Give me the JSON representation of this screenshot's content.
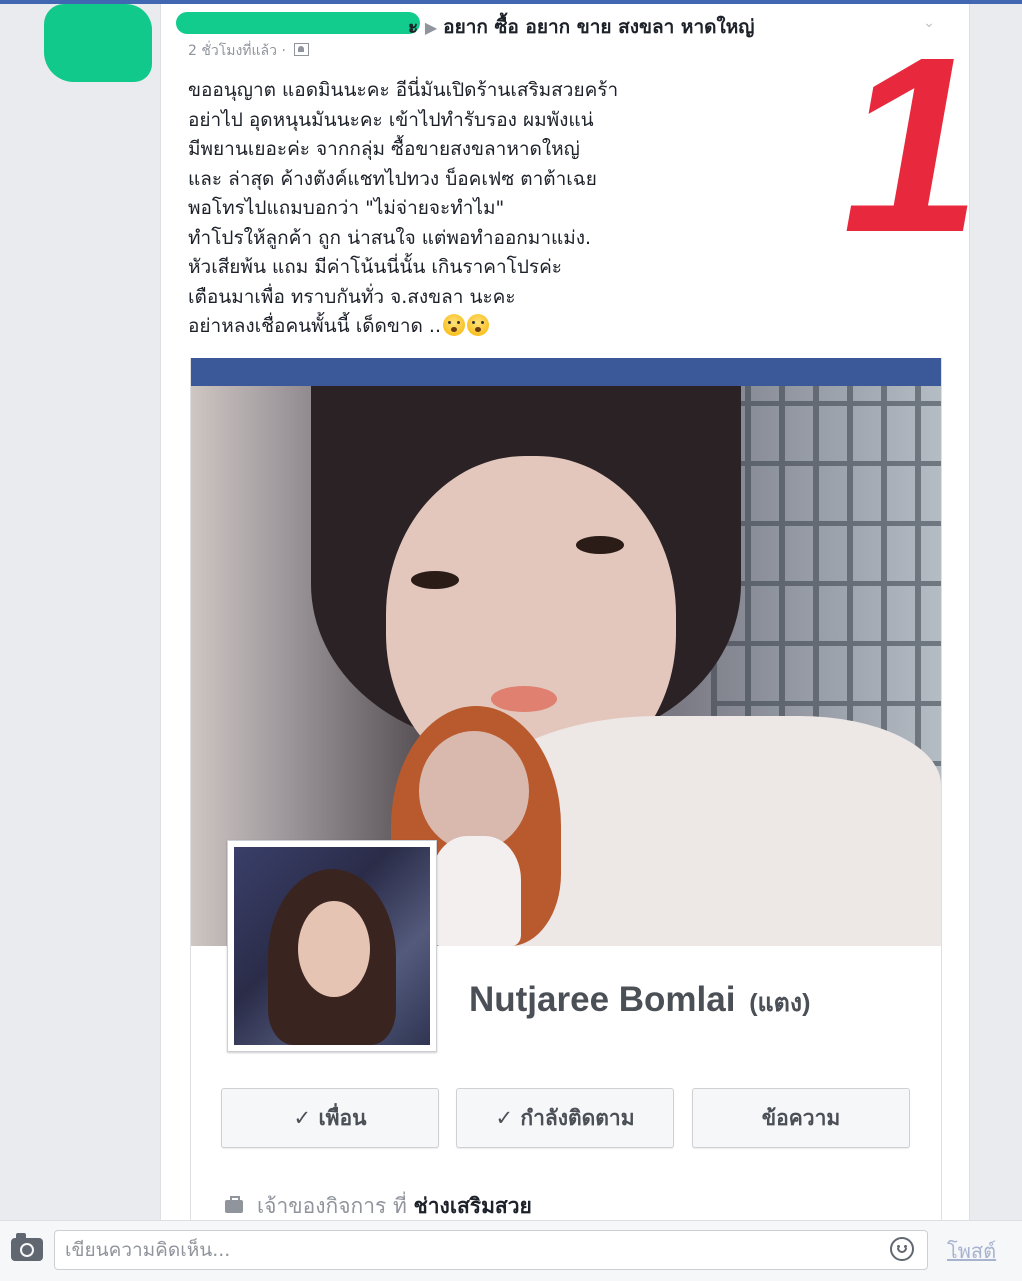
{
  "post": {
    "group_name": "อยาก ซื้อ อยาก ขาย สงขลา หาดใหญ่",
    "author_suffix": "ะ",
    "timestamp": "2 ชั่วโมงที่แล้ว ·",
    "annotation_number": "1",
    "body_lines": [
      "ขออนุญาต แอดมินนะคะ อีนี่มันเปิดร้านเสริมสวยคร้า",
      "อย่าไป อุดหนุนมันนะคะ  เข้าไปทำรับรอง ผมพังแน่",
      "มีพยานเยอะค่ะ จากกลุ่ม ซื้อขายสงขลาหาดใหญ่",
      " และ ล่าสุด ค้างตังค์แชทไปทวง บ็อคเฟซ ตาต้าเฉย",
      "พอโทรไปแถมบอกว่า \"ไม่จ่ายจะทำไม\"",
      "ทำโปรให้ลูกค้า ถูก น่าสนใจ แต่พอทำออกมาแม่ง.",
      "หัวเสียพ้น แถม มีค่าโน้นนี่นั้น เกินราคาโปรค่ะ",
      "เตือนมาเพื่อ ทราบกันทั่ว จ.สงขลา นะคะ",
      "อย่าหลงเชื่อคนพั้นนี้  เด็ดขาด .."
    ]
  },
  "profile": {
    "name": "Nutjaree Bomlai",
    "alt_name": "(แตง)",
    "buttons": {
      "friends": "✓ เพื่อน",
      "following": "✓ กำลังติดตาม",
      "message": "ข้อความ"
    },
    "info_prefix": "เจ้าของกิจการ ที่",
    "info_bold": "ช่างเสริมสวย"
  },
  "comment_bar": {
    "placeholder": "เขียนความคิดเห็น...",
    "post_label": "โพสต์"
  },
  "colors": {
    "fb_blue": "#3b5998",
    "annotation_red": "#e8283c",
    "redaction_green": "#10c98a"
  }
}
